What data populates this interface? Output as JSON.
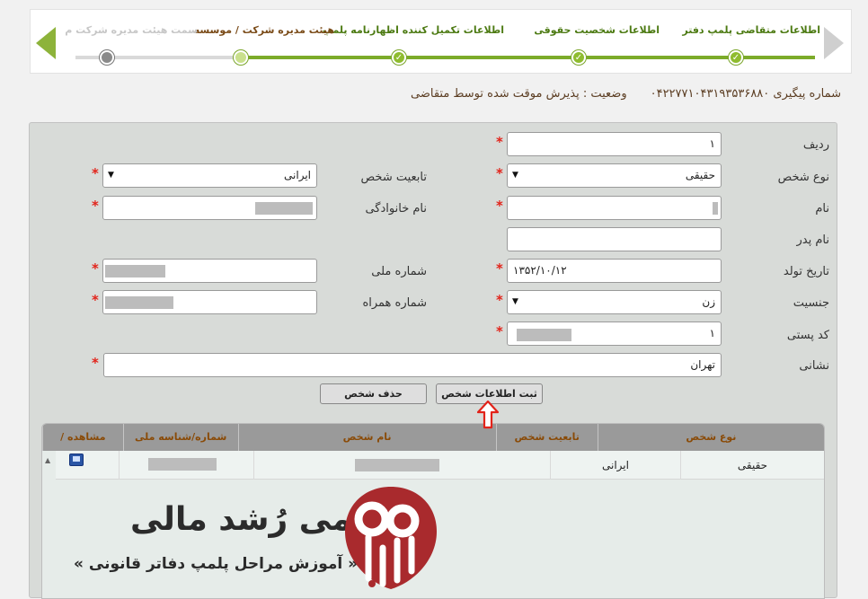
{
  "stepper": {
    "steps": [
      {
        "label": "اطلاعات متقاضی پلمپ دفتر",
        "state": "done"
      },
      {
        "label": "اطلاعات شخصیت حقوقی",
        "state": "done"
      },
      {
        "label": "اطلاعات تکمیل کننده اظهارنامه پلمپ",
        "state": "done"
      },
      {
        "label": "هیئت مدیره شرکت / موسسه",
        "state": "current"
      },
      {
        "label": "سمت هیئت مدیره شرکت م",
        "state": "future"
      }
    ],
    "check_mark": "✓"
  },
  "tracking": {
    "number_text": "شماره پیگیری ۰۴۲۲۷۷۱۰۴۳۱۹۳۵۳۶۸۸۰",
    "status_text": "وضعیت : پذیرش موقت شده توسط متقاضی"
  },
  "form": {
    "row_label": "ردیف",
    "row_value": "۱",
    "person_type_label": "نوع شخص",
    "person_type_value": "حقیقی",
    "nationality_label": "تابعیت شخص",
    "nationality_value": "ایرانی",
    "first_name_label": "نام",
    "last_name_label": "نام خانوادگی",
    "father_name_label": "نام پدر",
    "birth_date_label": "تاریخ تولد",
    "birth_date_value": "۱۳۵۲/۱۰/۱۲",
    "national_id_label": "شماره ملی",
    "gender_label": "جنسیت",
    "gender_value": "زن",
    "mobile_label": "شماره همراه",
    "postal_code_label": "کد پستی",
    "postal_code_prefix": "۱",
    "address_label": "نشانی",
    "address_value": "تهران",
    "required_mark": "*",
    "save_button": "ثبت اطلاعات شخص",
    "delete_button": "حذف شخص"
  },
  "table": {
    "columns": [
      "نوع شخص",
      "تابعیت شخص",
      "نام شخص",
      "شماره/شناسه ملی",
      "مشاهده / ویرایش"
    ],
    "rows": [
      {
        "person_type": "حقیقی",
        "nationality": "ایرانی"
      }
    ]
  },
  "watermark": {
    "title": "آکادمی رُشد مالی",
    "subtitle": "« آموزش مراحل پلمپ دفاتر قانونی »"
  },
  "colors": {
    "accent_green": "#7cab2a",
    "required_red": "#e2231a",
    "header_text": "#8a4b08",
    "logo_red": "#a92a2d"
  }
}
